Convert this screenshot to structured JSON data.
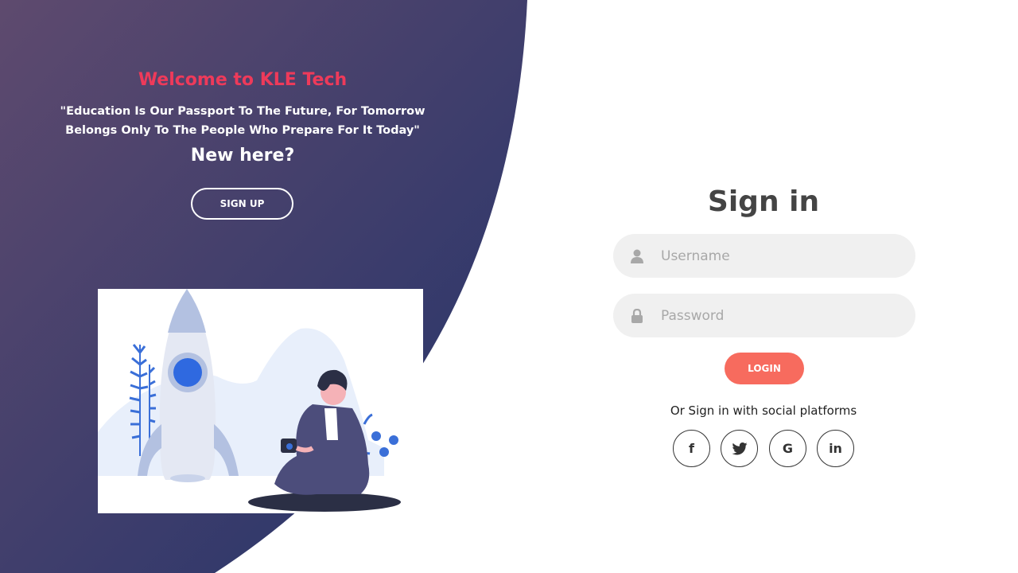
{
  "left": {
    "welcome": "Welcome to KLE Tech",
    "quote": "\"Education Is Our Passport To The Future, For Tomorrow Belongs Only To The People Who Prepare For It Today\"",
    "new_here": "New here?",
    "signup_label": "SIGN UP"
  },
  "signin": {
    "title": "Sign in",
    "username_placeholder": "Username",
    "password_placeholder": "Password",
    "login_label": "LOGIN",
    "social_text": "Or Sign in with social platforms",
    "social": [
      {
        "icon": "facebook-icon",
        "glyph": "f"
      },
      {
        "icon": "twitter-icon",
        "glyph": "twitter"
      },
      {
        "icon": "google-icon",
        "glyph": "G"
      },
      {
        "icon": "linkedin-icon",
        "glyph": "in"
      }
    ]
  },
  "colors": {
    "gradient_start": "#5e4a6e",
    "gradient_end": "#2b3a6e",
    "welcome": "#ee3a5a",
    "login_button": "#f76b5e",
    "field_bg": "#f0f0f0"
  }
}
